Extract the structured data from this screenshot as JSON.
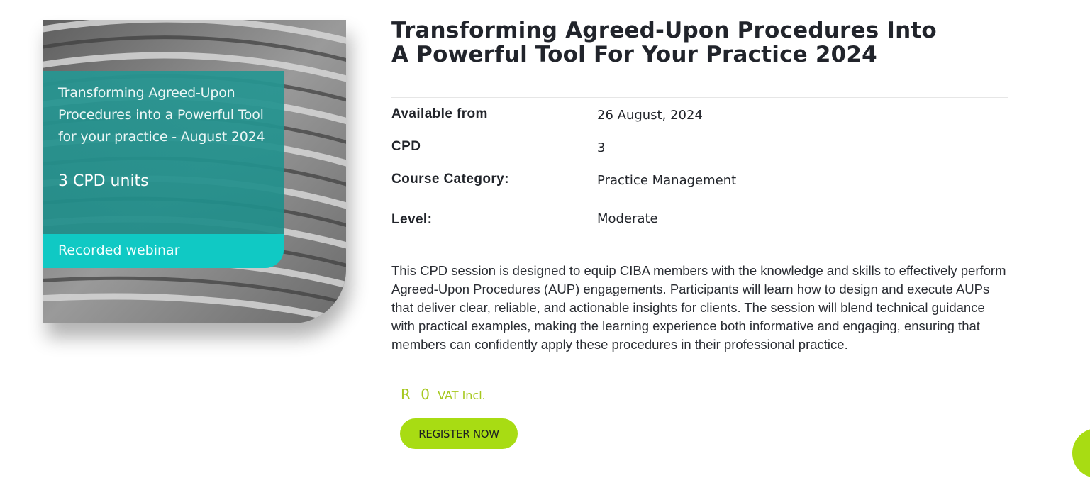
{
  "image": {
    "card_title": "Transforming Agreed-Upon Procedures into a Powerful Tool for your practice - August 2024",
    "card_units": "3 CPD units",
    "card_format": "Recorded webinar"
  },
  "course": {
    "title": "Transforming Agreed-Upon Procedures Into A Powerful Tool For Your Practice 2024",
    "details": [
      {
        "label": "Available from",
        "value": "26 August, 2024"
      },
      {
        "label": "CPD",
        "value": "3"
      },
      {
        "label": "Course Category:",
        "value": "Practice Management"
      },
      {
        "label": "Level:",
        "value": "Moderate"
      }
    ],
    "description": "This CPD session is designed to equip CIBA members with the knowledge and skills to effectively perform Agreed-Upon Procedures (AUP) engagements. Participants will learn how to design and execute AUPs that deliver clear, reliable, and actionable insights for clients. The session will blend technical guidance with practical examples, making the learning experience both informative and engaging, ensuring that members can confidently apply these procedures in their professional practice.",
    "price": {
      "amount": "R 0",
      "note": "VAT Incl."
    },
    "register_label": "REGISTER NOW"
  },
  "colors": {
    "teal": "#269692",
    "teal_band": "#10c9c4",
    "accent_green": "#a8dc13",
    "price_green": "#a6c81e"
  }
}
